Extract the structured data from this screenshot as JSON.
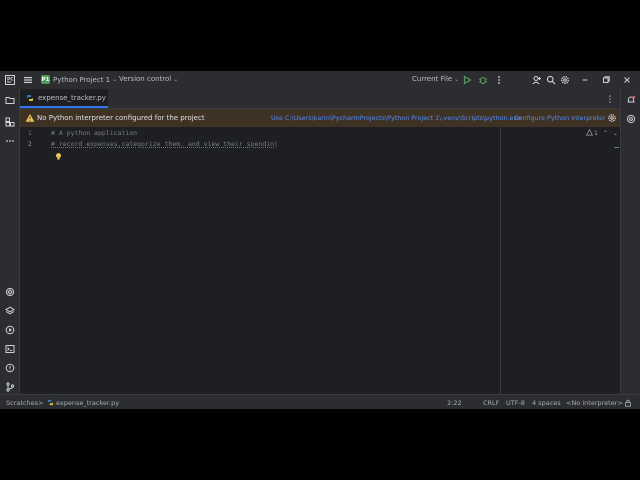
{
  "titlebar": {
    "project_badge": "P1",
    "project_name": "Python Project 1",
    "vcs_label": "Version control",
    "run_config": "Current File"
  },
  "tab": {
    "file_name": "expense_tracker.py"
  },
  "warning": {
    "message": "No Python interpreter configured for the project",
    "use_link": "Use C:\\Users\\karin\\PycharmProjects\\Python Project 1\\.venv\\Scripts\\python.exe",
    "configure_link": "Configure Python interpreter"
  },
  "editor": {
    "lines": [
      {
        "number": "1",
        "text": "# A python application"
      },
      {
        "number": "2",
        "text": "# record expenses,categorize them, and view their spendin|"
      }
    ],
    "inspection_count": "1"
  },
  "statusbar": {
    "breadcrumb_root": "Scratches",
    "breadcrumb_sep": ">",
    "breadcrumb_file": "expense_tracker.py",
    "position": "2:22",
    "line_separator": "CRLF",
    "encoding": "UTF-8",
    "indent": "4 spaces",
    "interpreter": "<No interpreter>"
  },
  "colors": {
    "accent": "#3574f0",
    "warning_bg": "#3d3223",
    "link": "#548af7",
    "run_green": "#57965c"
  }
}
